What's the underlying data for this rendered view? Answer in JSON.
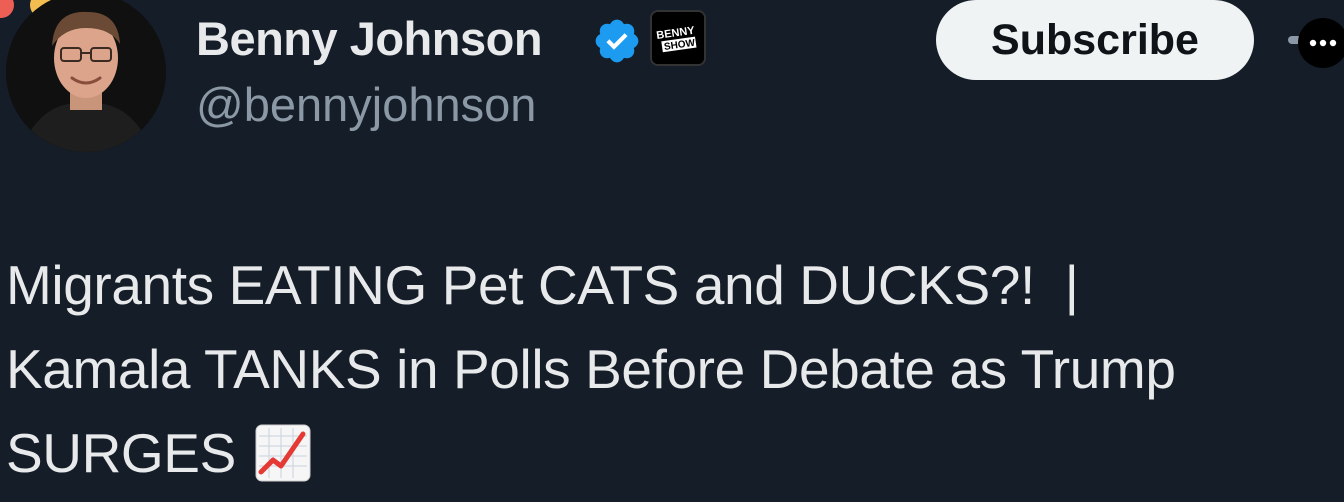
{
  "colors": {
    "background": "#151d28",
    "primary_text": "#e7e9ea",
    "secondary_text": "#8b98a5",
    "verified_blue": "#1d9bf0",
    "button_bg": "#eff3f4"
  },
  "window": {
    "controls": [
      "close",
      "minimize",
      "zoom"
    ]
  },
  "profile": {
    "display_name": "Benny Johnson",
    "handle": "@bennyjohnson",
    "verified_icon": "verified-badge-icon",
    "affiliate_badge_text": [
      "BENNY",
      "SHOW"
    ],
    "avatar": "profile-photo"
  },
  "actions": {
    "subscribe_label": "Subscribe",
    "more_icon": "ellipsis-icon"
  },
  "tweet": {
    "line1": "Migrants EATING Pet CATS and DUCKS?!  |",
    "line2": "Kamala TANKS in Polls Before Debate as Trump",
    "line3": "SURGES",
    "emoji_icon": "chart-increasing-emoji"
  }
}
